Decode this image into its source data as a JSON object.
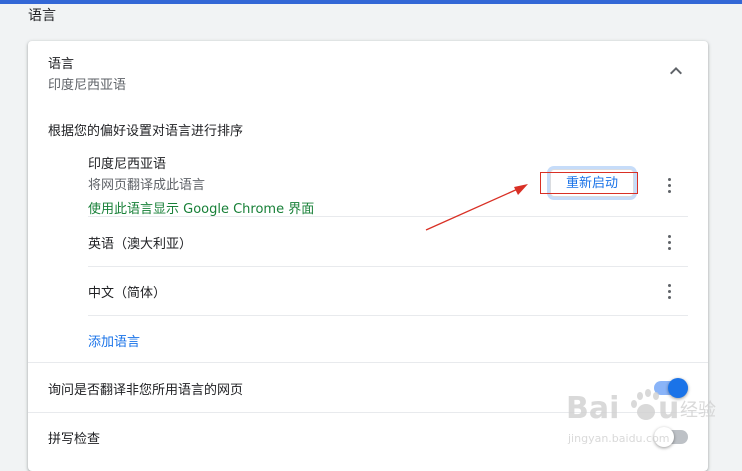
{
  "section": {
    "title": "语言"
  },
  "card": {
    "header": {
      "title": "语言",
      "subtitle": "印度尼西亚语",
      "collapse_icon": "chevron-up-icon"
    },
    "order_label": "根据您的偏好设置对语言进行排序",
    "languages": [
      {
        "name": "印度尼西亚语",
        "description": "将网页翻译成此语言",
        "ui_status": "使用此语言显示 Google Chrome 界面",
        "action_label": "重新启动"
      },
      {
        "name": "英语（澳大利亚）"
      },
      {
        "name": "中文（简体）"
      }
    ],
    "add_language_label": "添加语言",
    "translate_prompt": {
      "label": "询问是否翻译非您所用语言的网页",
      "enabled": true
    },
    "spell_check": {
      "label": "拼写检查",
      "enabled": false
    }
  },
  "colors": {
    "accent": "#1a73e8",
    "green_text": "#188038",
    "annotation": "#d93025",
    "top_bar": "#3367d6"
  },
  "watermark": {
    "brand": "Baidu经验",
    "url": "jingyan.baidu.com"
  }
}
